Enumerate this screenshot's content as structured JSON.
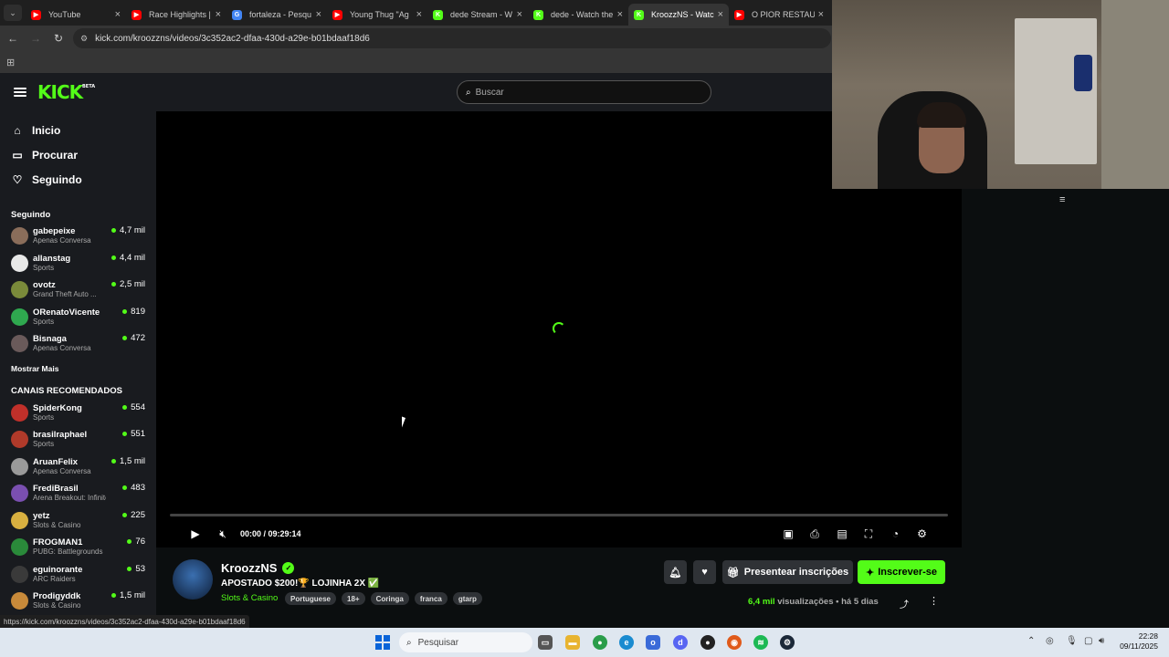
{
  "browser": {
    "tabs": [
      {
        "title": "YouTube",
        "color": "#ff0000",
        "glyph": "▶"
      },
      {
        "title": "Race Highlights |",
        "color": "#ff0000",
        "glyph": "▶"
      },
      {
        "title": "fortaleza - Pesqu",
        "color": "#4285f4",
        "glyph": "G"
      },
      {
        "title": "Young Thug \"Ag",
        "color": "#ff0000",
        "glyph": "▶"
      },
      {
        "title": "dede Stream - W",
        "color": "#53fc18",
        "glyph": "K"
      },
      {
        "title": "dede - Watch the",
        "color": "#53fc18",
        "glyph": "K"
      },
      {
        "title": "KroozzNS - Watc",
        "color": "#53fc18",
        "glyph": "K"
      },
      {
        "title": "O PIOR RESTAUR",
        "color": "#ff0000",
        "glyph": "▶"
      }
    ],
    "url": "kick.com/kroozzns/videos/3c352ac2-dfaa-430d-a29e-b01bdaaf18d6",
    "status_url": "https://kick.com/kroozzns/videos/3c352ac2-dfaa-430d-a29e-b01bdaaf18d6"
  },
  "header": {
    "logo": "KICK",
    "logo_badge": "BETA",
    "search_placeholder": "Buscar"
  },
  "sidebar": {
    "nav": [
      {
        "label": "Inicio",
        "icon": "home-icon",
        "glyph": "⌂"
      },
      {
        "label": "Procurar",
        "icon": "browse-icon",
        "glyph": "▭"
      },
      {
        "label": "Seguindo",
        "icon": "heart-icon",
        "glyph": "♡"
      }
    ],
    "following_title": "Seguindo",
    "following": [
      {
        "name": "gabepeixe",
        "category": "Apenas Conversa",
        "viewers": "4,7 mil",
        "color": "#8a6d5a"
      },
      {
        "name": "allanstag",
        "category": "Sports",
        "viewers": "4,4 mil",
        "color": "#e8e8e8"
      },
      {
        "name": "ovotz",
        "category": "Grand Theft Auto ...",
        "viewers": "2,5 mil",
        "color": "#7a8a3a"
      },
      {
        "name": "ORenatoVicente",
        "category": "Sports",
        "viewers": "819",
        "color": "#2fa84f"
      },
      {
        "name": "Bisnaga",
        "category": "Apenas Conversa",
        "viewers": "472",
        "color": "#6a5a5a"
      }
    ],
    "show_more": "Mostrar Mais",
    "recommended_title": "CANAIS RECOMENDADOS",
    "recommended": [
      {
        "name": "SpiderKong",
        "category": "Sports",
        "viewers": "554",
        "color": "#c0302a"
      },
      {
        "name": "brasilraphael",
        "category": "Sports",
        "viewers": "551",
        "color": "#b03a2a"
      },
      {
        "name": "AruanFelix",
        "category": "Apenas Conversa",
        "viewers": "1,5 mil",
        "color": "#9a9a9a"
      },
      {
        "name": "FrediBrasil",
        "category": "Arena Breakout: Infinite",
        "viewers": "483",
        "color": "#7a4fb0"
      },
      {
        "name": "yetz",
        "category": "Slots & Casino",
        "viewers": "225",
        "color": "#d8b040"
      },
      {
        "name": "FROGMAN1",
        "category": "PUBG: Battlegrounds",
        "viewers": "76",
        "color": "#2a8a3a"
      },
      {
        "name": "eguinorante",
        "category": "ARC Raiders",
        "viewers": "53",
        "color": "#3a3a3a"
      },
      {
        "name": "Prodigyddk",
        "category": "Slots & Casino",
        "viewers": "1,5 mil",
        "color": "#c88a3a"
      }
    ]
  },
  "player": {
    "time": "00:00 / 09:29:14",
    "progress": 0
  },
  "stream": {
    "streamer": "KroozzNS",
    "title": "APOSTADO $200!🏆 LOJINHA 2X ✅",
    "category": "Slots & Casino",
    "tags": [
      "Portuguese",
      "18+",
      "Coringa",
      "franca",
      "gtarp"
    ],
    "gift_label": "Presentear inscrições",
    "subscribe_label": "Inscrever-se",
    "views_count": "6,4 mil",
    "views_label": "visualizações",
    "age": "há 5 dias"
  },
  "taskbar": {
    "search_placeholder": "Pesquisar",
    "time": "22:28",
    "date": "09/11/2025"
  }
}
